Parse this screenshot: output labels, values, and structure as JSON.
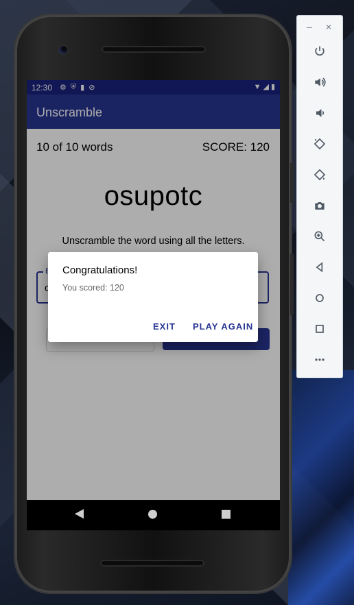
{
  "status_bar": {
    "time": "12:30"
  },
  "app": {
    "title": "Unscramble",
    "word_count": "10 of 10 words",
    "score": "SCORE: 120",
    "scrambled_word": "osupotc",
    "instructions": "Unscramble the word using all the letters.",
    "field_label": "E",
    "field_value": "c"
  },
  "dialog": {
    "title": "Congratulations!",
    "message": "You scored: 120",
    "exit_label": "EXIT",
    "play_again_label": "PLAY AGAIN"
  },
  "emulator_toolbar": {
    "minimize": "–",
    "close": "×",
    "items": [
      "power-icon",
      "volume-up-icon",
      "volume-down-icon",
      "rotate-left-icon",
      "rotate-right-icon",
      "camera-icon",
      "zoom-icon",
      "back-icon",
      "home-icon",
      "overview-icon",
      "more-icon"
    ]
  },
  "colors": {
    "primary": "#283593",
    "primary_dark": "#1a237e"
  }
}
